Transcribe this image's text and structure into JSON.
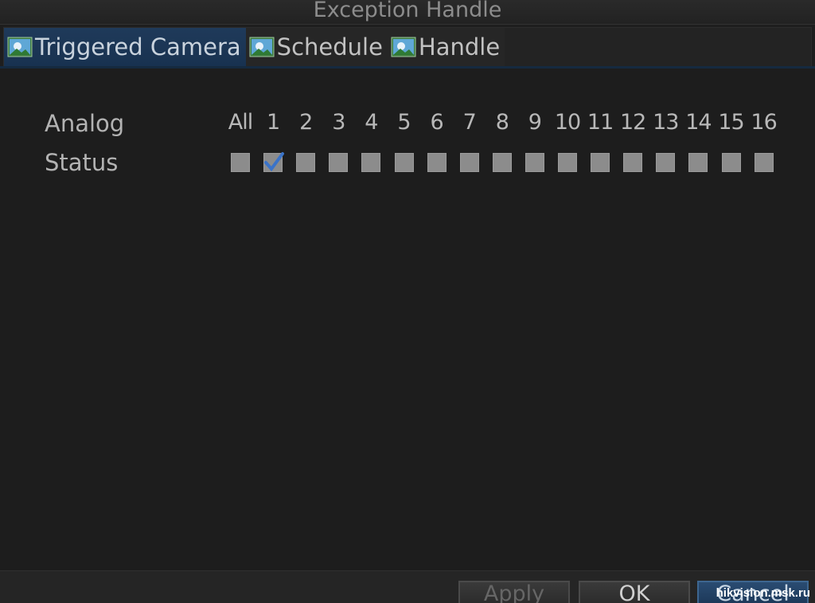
{
  "window": {
    "title": "Exception Handle"
  },
  "tabs": [
    {
      "label": "Triggered Camera",
      "icon": "camera-icon",
      "active": true
    },
    {
      "label": "Schedule",
      "icon": "camera-icon",
      "active": false
    },
    {
      "label": "Handle",
      "icon": "camera-icon",
      "active": false
    }
  ],
  "grid": {
    "row_header_label": "Analog",
    "row_status_label": "Status",
    "columns": [
      "All",
      "1",
      "2",
      "3",
      "4",
      "5",
      "6",
      "7",
      "8",
      "9",
      "10",
      "11",
      "12",
      "13",
      "14",
      "15",
      "16"
    ],
    "checked": [
      false,
      true,
      false,
      false,
      false,
      false,
      false,
      false,
      false,
      false,
      false,
      false,
      false,
      false,
      false,
      false,
      false
    ]
  },
  "footer": {
    "apply_label": "Apply",
    "ok_label": "OK",
    "cancel_label": "Cancel"
  },
  "watermark": "hikvision.msk.ru",
  "colors": {
    "active_tab": "#1f3a5a",
    "checkmark": "#3a73c8",
    "checkbox": "#8c8c8c"
  }
}
